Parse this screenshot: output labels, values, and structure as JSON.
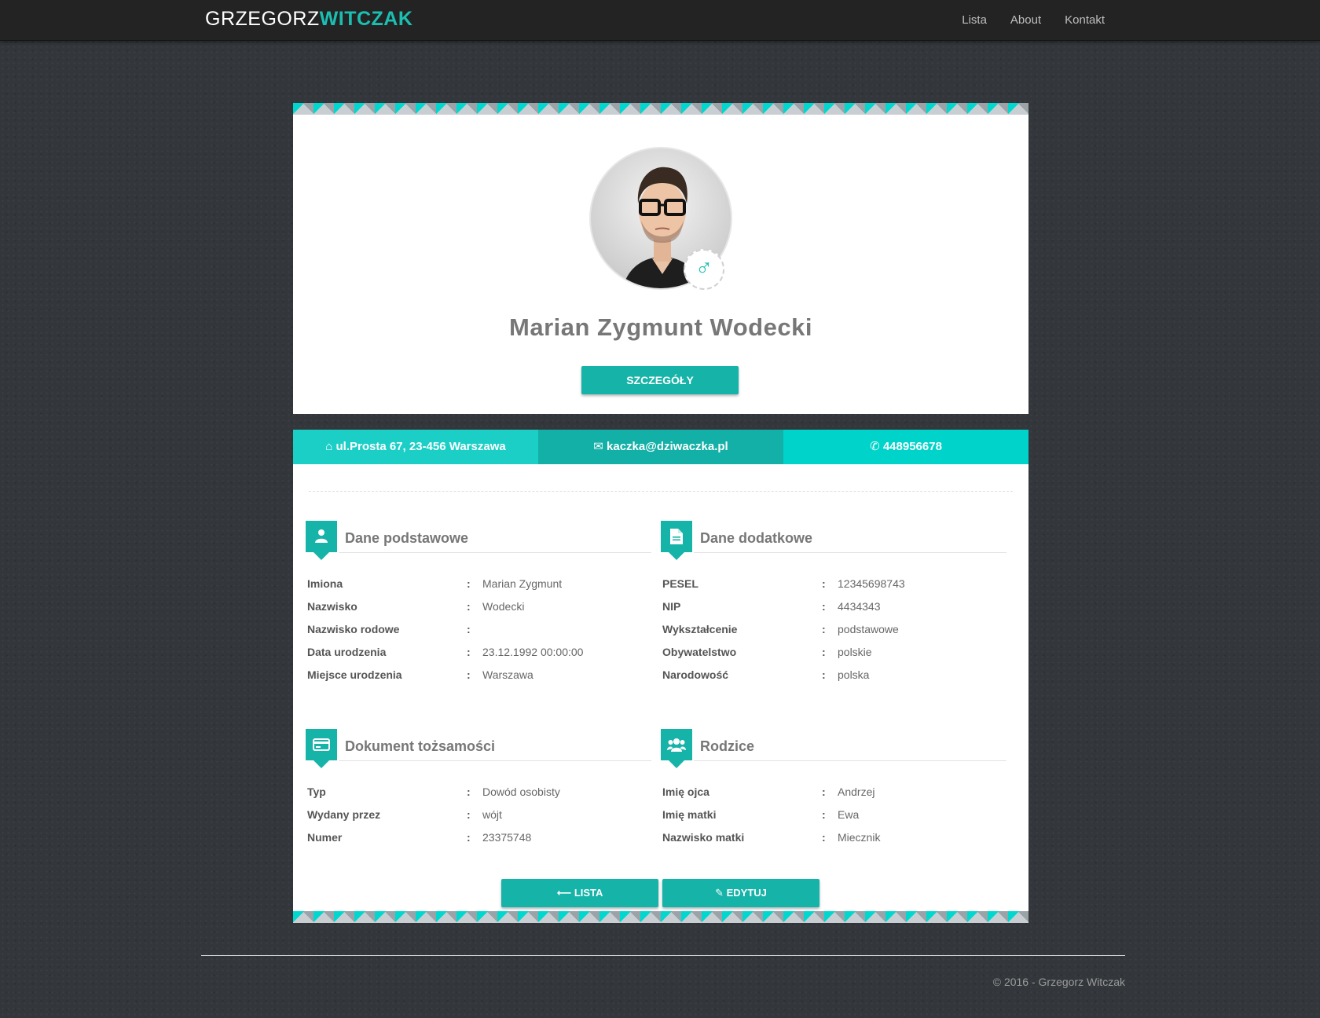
{
  "navbar": {
    "brand_first": "GRZEGORZ",
    "brand_second": "WITCZAK",
    "links": [
      "Lista",
      "About",
      "Kontakt"
    ]
  },
  "profile": {
    "name": "Marian Zygmunt Wodecki",
    "gender_symbol": "♂",
    "details_button": "SZCZEGÓŁY"
  },
  "contact": {
    "address": "ul.Prosta 67, 23-456 Warszawa",
    "email": "kaczka@dziwaczka.pl",
    "phone": "448956678"
  },
  "sections": {
    "basic": {
      "title": "Dane podstawowe",
      "rows": [
        {
          "label": "Imiona",
          "value": "Marian Zygmunt"
        },
        {
          "label": "Nazwisko",
          "value": "Wodecki"
        },
        {
          "label": "Nazwisko rodowe",
          "value": ""
        },
        {
          "label": "Data urodzenia",
          "value": "23.12.1992 00:00:00"
        },
        {
          "label": "Miejsce urodzenia",
          "value": "Warszawa"
        }
      ]
    },
    "extra": {
      "title": "Dane dodatkowe",
      "rows": [
        {
          "label": "PESEL",
          "value": "12345698743"
        },
        {
          "label": "NIP",
          "value": "4434343"
        },
        {
          "label": "Wykształcenie",
          "value": "podstawowe"
        },
        {
          "label": "Obywatelstwo",
          "value": "polskie"
        },
        {
          "label": "Narodowość",
          "value": "polska"
        }
      ]
    },
    "document": {
      "title": "Dokument tożsamości",
      "rows": [
        {
          "label": "Typ",
          "value": "Dowód osobisty"
        },
        {
          "label": "Wydany przez",
          "value": "wójt"
        },
        {
          "label": "Numer",
          "value": "23375748"
        }
      ]
    },
    "parents": {
      "title": "Rodzice",
      "rows": [
        {
          "label": "Imię ojca",
          "value": "Andrzej"
        },
        {
          "label": "Imię matki",
          "value": "Ewa"
        },
        {
          "label": "Nazwisko matki",
          "value": "Miecznik"
        }
      ]
    }
  },
  "buttons": {
    "list": "LISTA",
    "edit": "EDYTUJ"
  },
  "footer": {
    "text": "© 2016 - Grzegorz Witczak"
  },
  "colors": {
    "accent": "#15b3a8",
    "accent_light": "#1ccfc6",
    "background": "#33373b"
  },
  "icons": {
    "address": "home-icon",
    "email": "envelope-icon",
    "phone": "phone-icon",
    "basic": "user-icon",
    "extra": "file-icon",
    "document": "credit-card-icon",
    "parents": "group-icon",
    "list_button": "arrow-left-icon",
    "edit_button": "edit-icon"
  }
}
